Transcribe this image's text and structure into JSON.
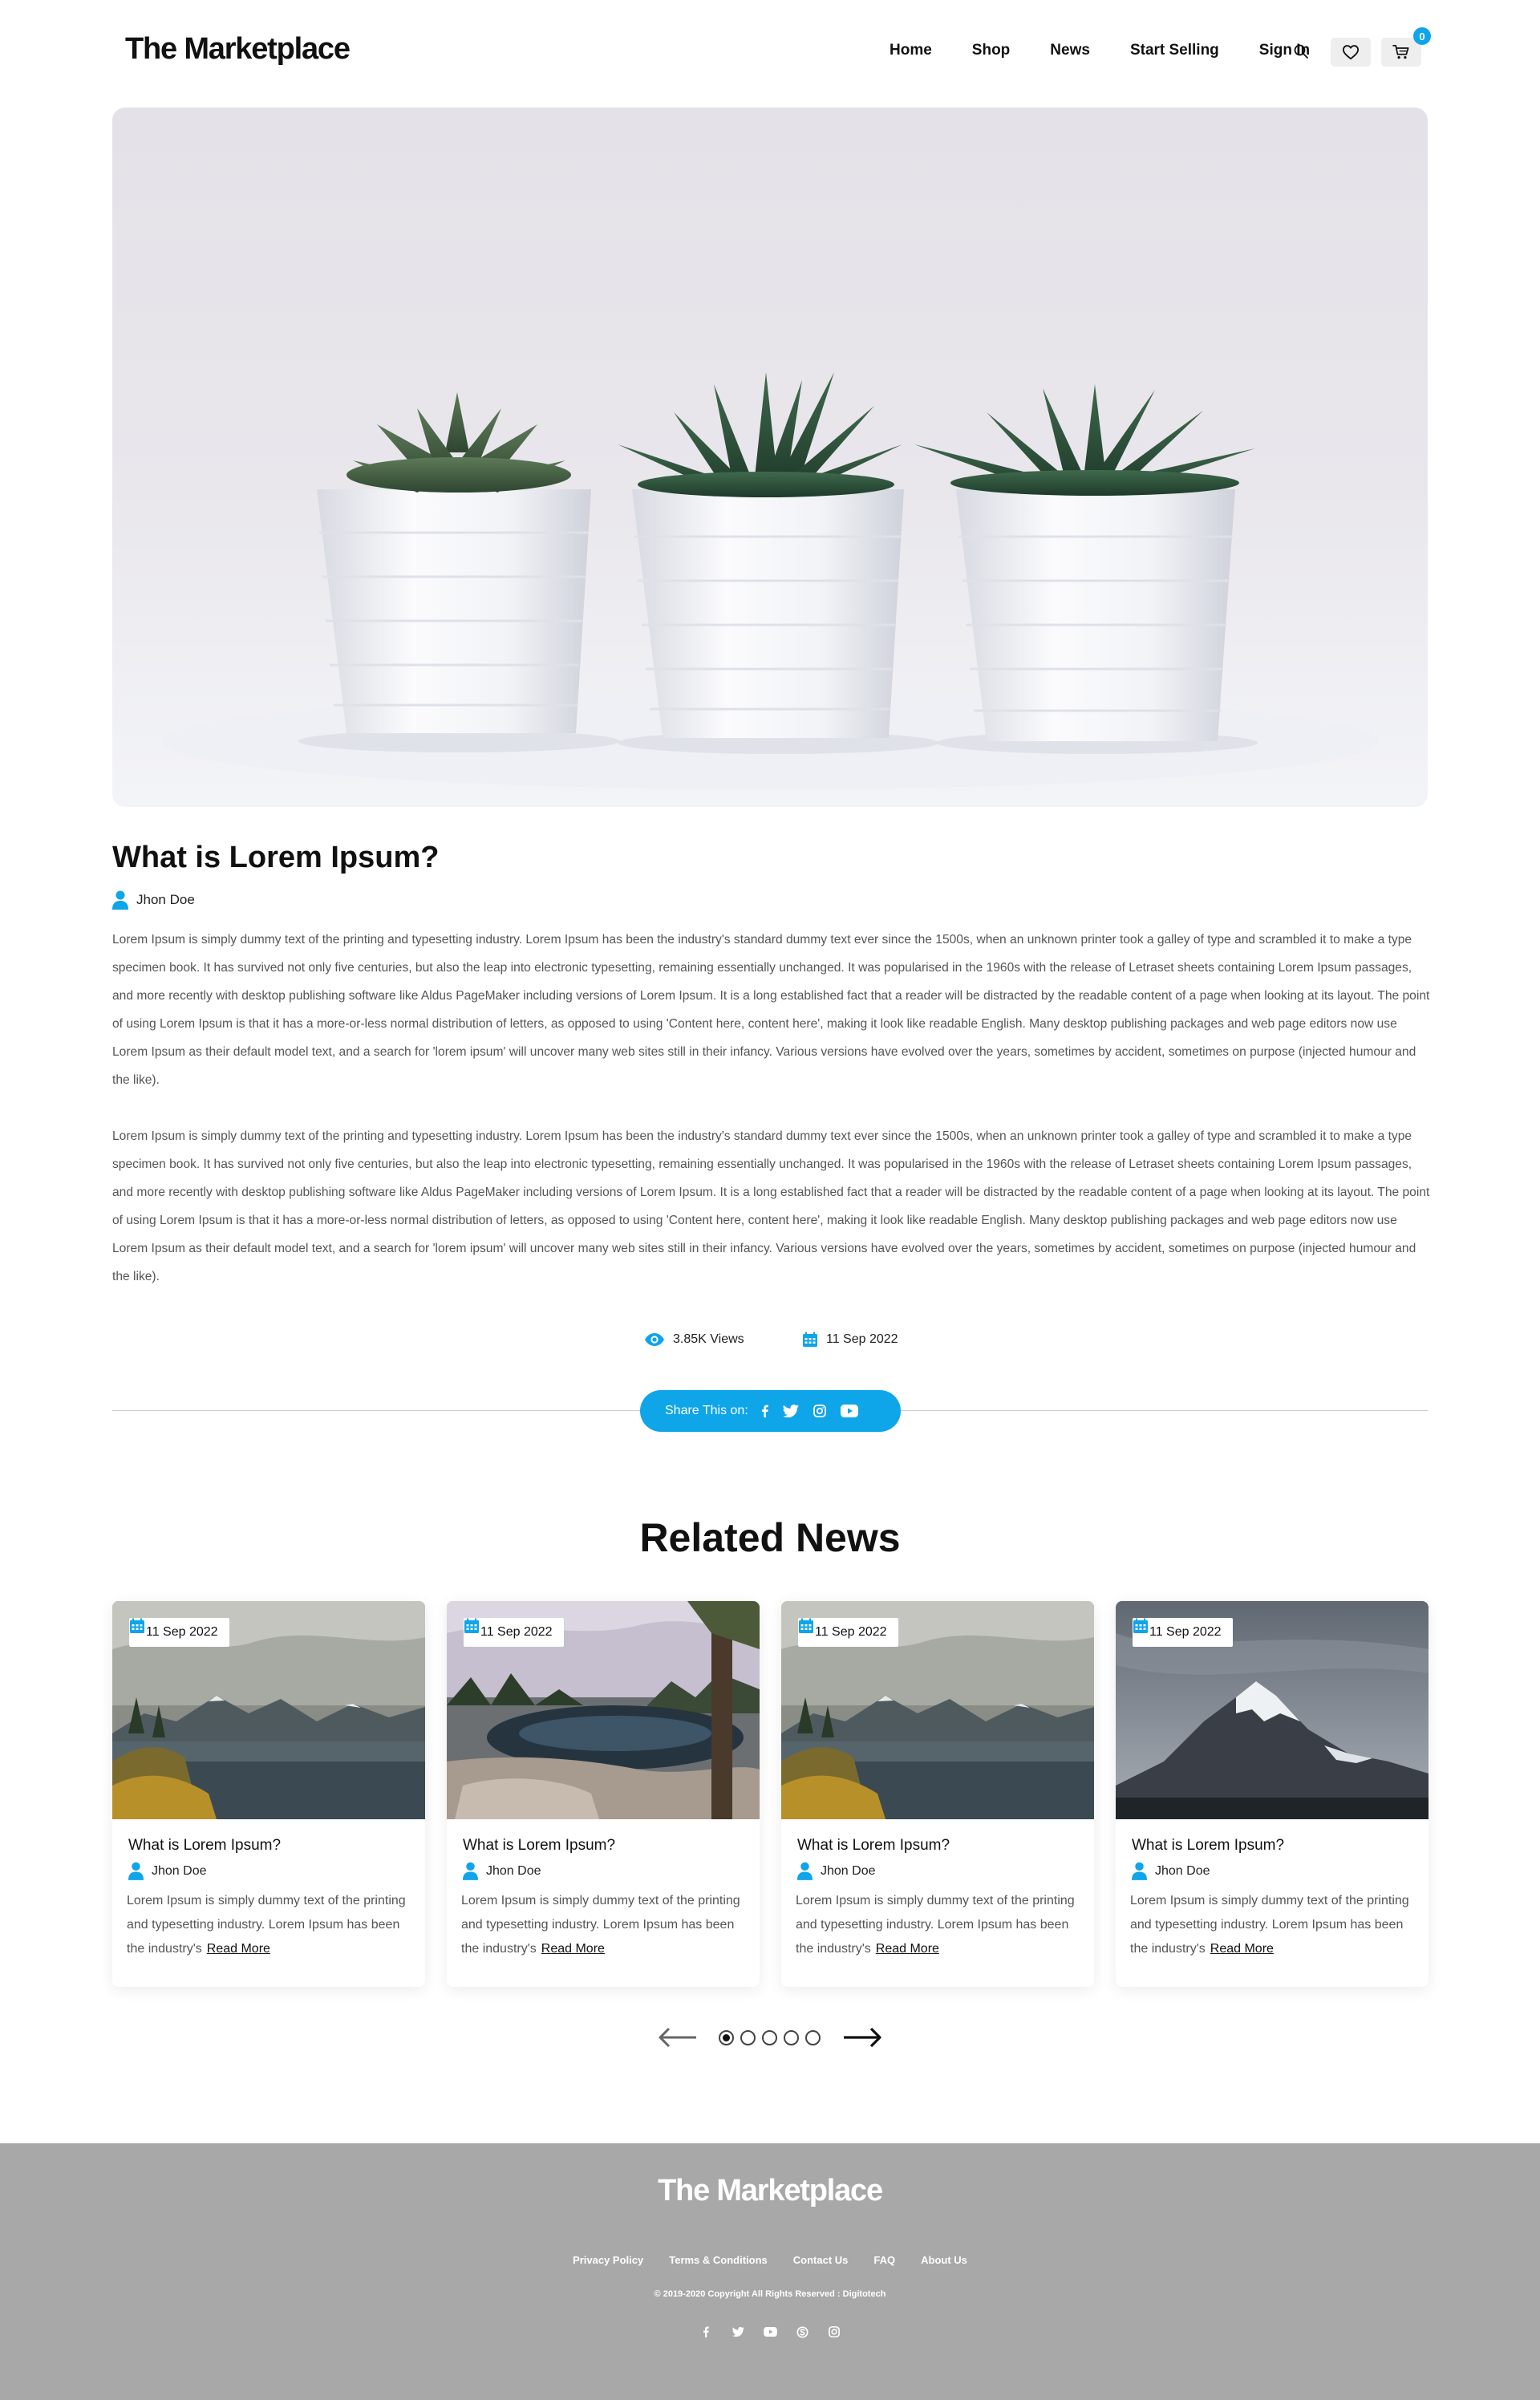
{
  "brand": {
    "name": "The Marketplace",
    "accent": "#0ea5e9"
  },
  "nav": {
    "items": [
      "Home",
      "Shop",
      "News",
      "Start Selling",
      "Sign In"
    ],
    "search_icon": "search-icon",
    "wishlist_icon": "heart-icon",
    "cart_icon": "cart-icon",
    "cart_count": "0"
  },
  "hero": {
    "image": "three potted succulents in white planters"
  },
  "article": {
    "title": "What is Lorem Ipsum?",
    "author": "Jhon Doe",
    "paragraphs": [
      "Lorem Ipsum is simply dummy text of the printing and typesetting industry. Lorem Ipsum has been the industry's standard dummy text ever since the 1500s, when an unknown printer took a galley of type and scrambled it to make a type specimen book. It has survived not only five centuries, but also the leap into electronic typesetting, remaining essentially unchanged. It was popularised in the 1960s with the release of Letraset sheets containing Lorem Ipsum passages, and more recently with desktop publishing software like Aldus PageMaker including versions of Lorem Ipsum. It is a long established fact that a reader will be distracted by the readable content of a page when looking at its layout. The point of using Lorem Ipsum is that it has a more-or-less normal distribution of letters, as opposed to using 'Content here, content here', making it look like readable English. Many desktop publishing packages and web page editors now use Lorem Ipsum as their default model text, and a search for 'lorem ipsum' will uncover many web sites still in their infancy. Various versions have evolved over the years, sometimes by accident, sometimes on purpose (injected humour and the like).",
      "Lorem Ipsum is simply dummy text of the printing and typesetting industry. Lorem Ipsum has been the industry's standard dummy text ever since the 1500s, when an unknown printer took a galley of type and scrambled it to make a type specimen book. It has survived not only five centuries, but also the leap into electronic typesetting, remaining essentially unchanged. It was popularised in the 1960s with the release of Letraset sheets containing Lorem Ipsum passages, and more recently with desktop publishing software like Aldus PageMaker including versions of Lorem Ipsum. It is a long established fact that a reader will be distracted by the readable content of a page when looking at its layout. The point of using Lorem Ipsum is that it has a more-or-less normal distribution of letters, as opposed to using 'Content here, content here', making it look like readable English. Many desktop publishing packages and web page editors now use Lorem Ipsum as their default model text, and a search for 'lorem ipsum' will uncover many web sites still in their infancy. Various versions have evolved over the years, sometimes by accident, sometimes on purpose (injected humour and the like)."
    ],
    "views": "3.85K Views",
    "date": "11 Sep 2022",
    "share_label": "Share This on:",
    "share_icons": [
      "facebook-icon",
      "twitter-icon",
      "instagram-icon",
      "youtube-icon"
    ]
  },
  "related": {
    "title": "Related News",
    "cards": [
      {
        "date": "11 Sep 2022",
        "title": "What is Lorem Ipsum?",
        "author": "Jhon Doe",
        "excerpt": "Lorem Ipsum is simply dummy text of the printing and typesetting industry. Lorem Ipsum has been the industry's",
        "read_more": "Read More",
        "image": "mountain lake at dusk"
      },
      {
        "date": "11 Sep 2022",
        "title": "What is Lorem Ipsum?",
        "author": "Jhon Doe",
        "excerpt": "Lorem Ipsum is simply dummy text of the printing and typesetting industry. Lorem Ipsum has been the industry's",
        "read_more": "Read More",
        "image": "forest lake with rocks"
      },
      {
        "date": "11 Sep 2022",
        "title": "What is Lorem Ipsum?",
        "author": "Jhon Doe",
        "excerpt": "Lorem Ipsum is simply dummy text of the printing and typesetting industry. Lorem Ipsum has been the industry's",
        "read_more": "Read More",
        "image": "mountain lake at dusk"
      },
      {
        "date": "11 Sep 2022",
        "title": "What is Lorem Ipsum?",
        "author": "Jhon Doe",
        "excerpt": "Lorem Ipsum is simply dummy text of the printing and typesetting industry. Lorem Ipsum has been the industry's",
        "read_more": "Read More",
        "image": "snowy mountain peak under cloudy sky"
      }
    ],
    "pagination": {
      "pages": 5,
      "current": 1
    }
  },
  "footer": {
    "brand": "The Marketplace",
    "links": [
      "Privacy Policy",
      "Terms & Conditions",
      "Contact Us",
      "FAQ",
      "About Us"
    ],
    "copyright": "© 2019-2020 Copyright All Rights Reserved : Digitotech",
    "social_icons": [
      "facebook-icon",
      "twitter-icon",
      "youtube-icon",
      "skype-icon",
      "instagram-icon"
    ]
  }
}
